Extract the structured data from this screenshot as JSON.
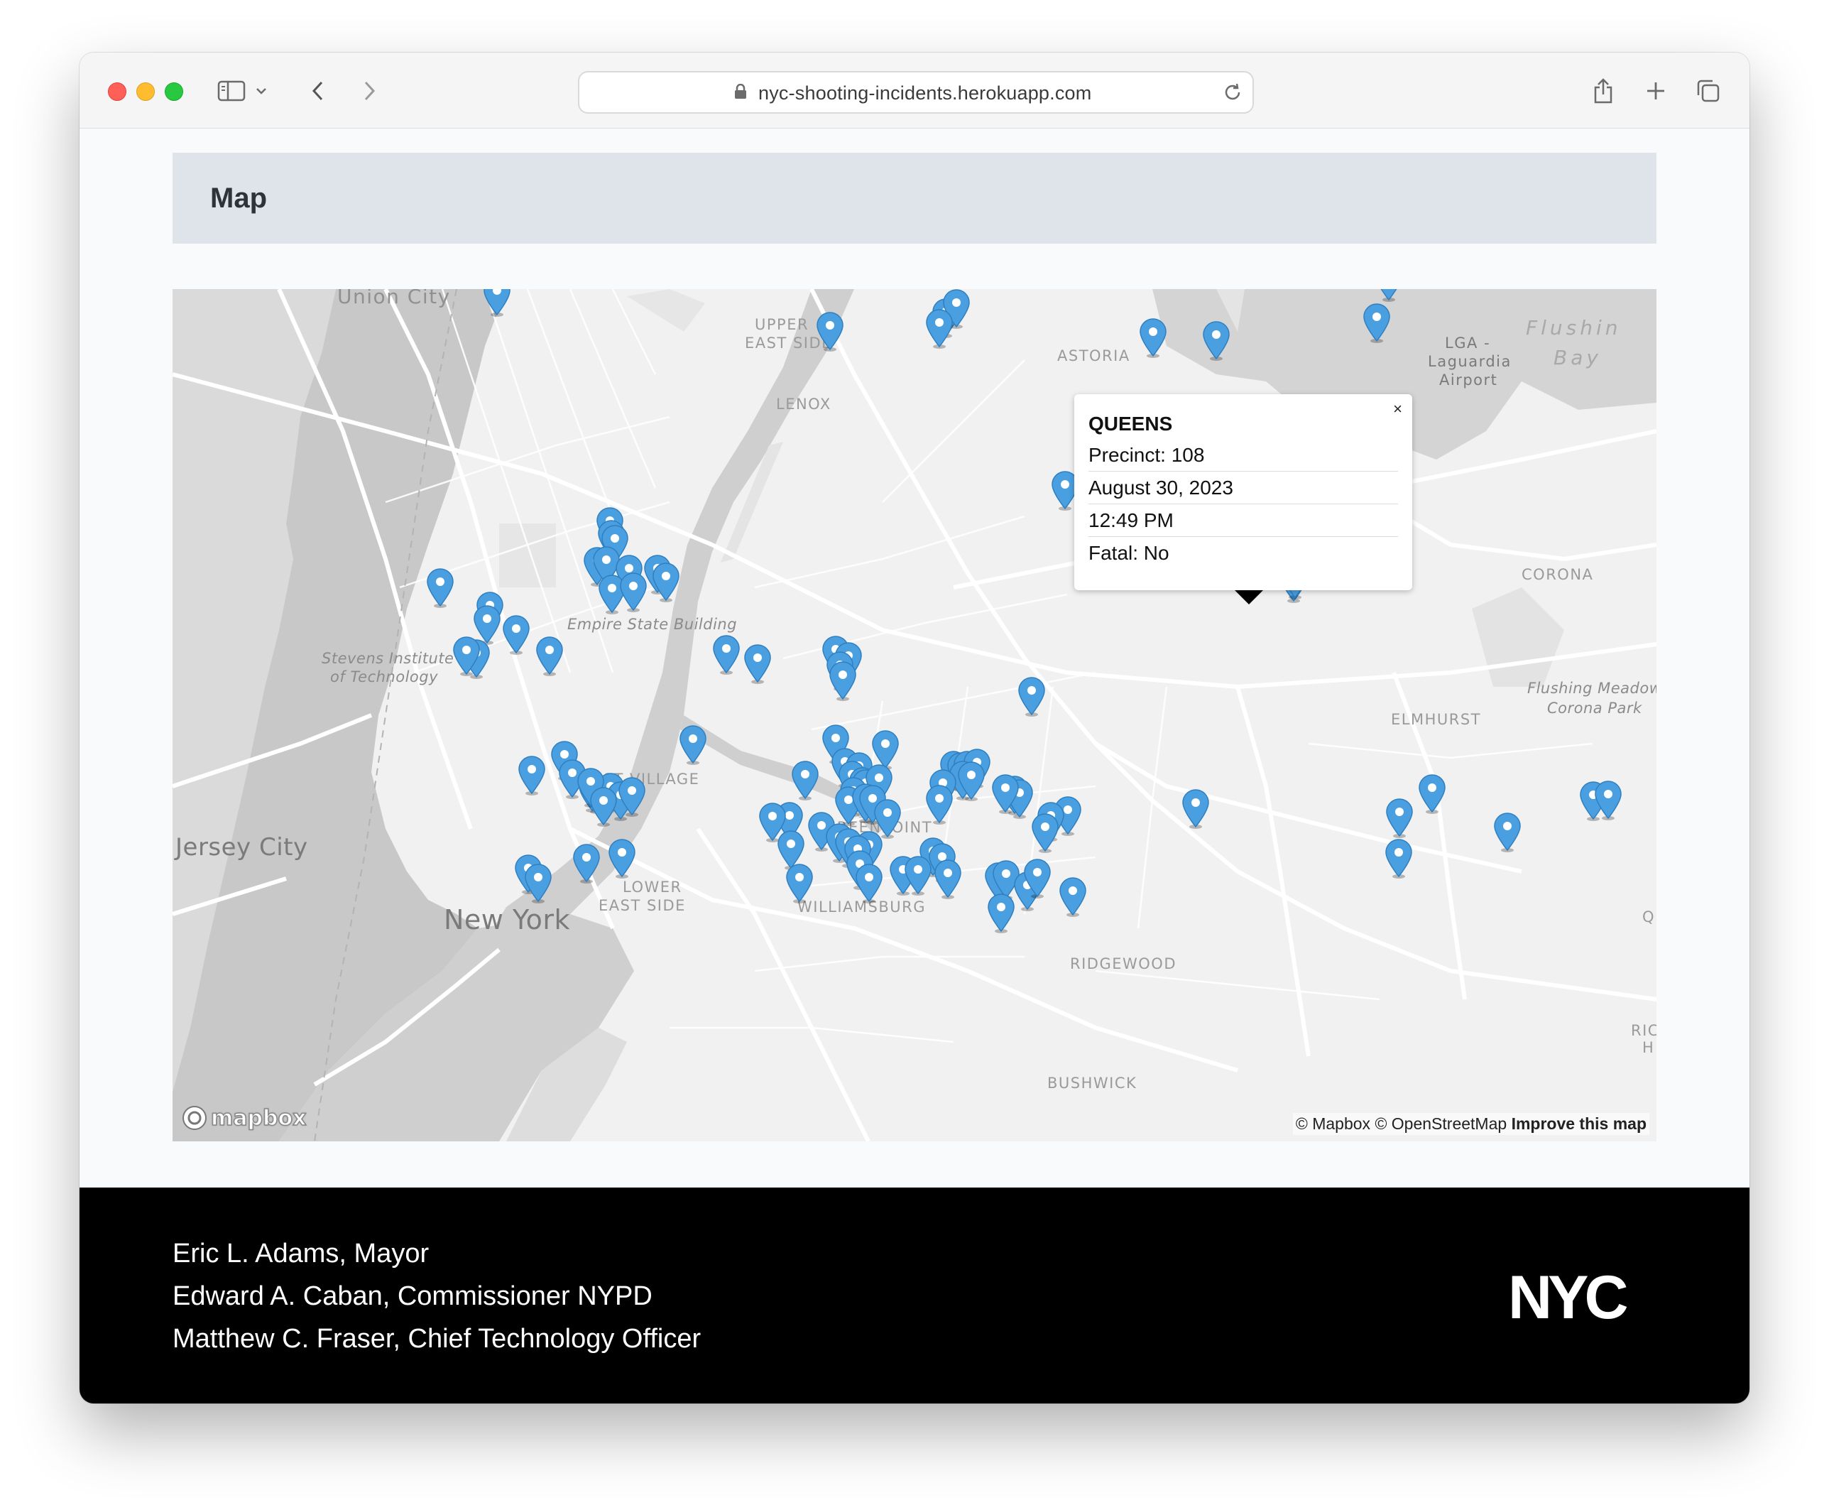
{
  "browser": {
    "url": "nyc-shooting-incidents.herokuapp.com"
  },
  "header": {
    "title": "Map"
  },
  "map": {
    "labels": {
      "union_city": "Union City",
      "upper_east_side_1": "UPPER",
      "upper_east_side_2": "EAST SIDE",
      "astoria": "ASTORIA",
      "lenox": "LENOX",
      "lga_1": "LGA -",
      "lga_2": "Laguardia",
      "lga_3": "Airport",
      "flushing_bay_1": "Flushin",
      "flushing_bay_2": "Bay",
      "empire": "Empire State Building",
      "stevens_1": "Stevens Institute",
      "stevens_2": "of Technology",
      "corona": "CORONA",
      "fmcp_1": "Flushing Meadows",
      "fmcp_2": "Corona Park",
      "elmhurst": "ELMHURST",
      "east_village": "EAST VILLAGE",
      "greenpoint": "GREENPOINT",
      "jersey_city": "Jersey City",
      "lower_east_side_1": "LOWER",
      "lower_east_side_2": "EAST SIDE",
      "new_york": "New York",
      "williamsburg": "WILLIAMSBURG",
      "ridgewood": "RIDGEWOOD",
      "bushwick": "BUSHWICK",
      "q": "Q",
      "rich_1": "RICH",
      "rich_2": "H"
    },
    "popup": {
      "borough": "QUEENS",
      "precinct": "Precinct: 108",
      "date": "August 30, 2023",
      "time": "12:49 PM",
      "fatal": "Fatal: No",
      "close": "×"
    },
    "logo": "mapbox",
    "attribution": {
      "mapbox": "© Mapbox",
      "osm": "© OpenStreetMap",
      "improve": "Improve this map"
    },
    "pin_color": "#4a9fe0"
  },
  "footer": {
    "line1": "Eric L. Adams, Mayor",
    "line2": "Edward A. Caban, Commissioner NYPD",
    "line3": "Matthew C. Fraser, Chief Technology Officer",
    "logo_text": "NYC"
  }
}
